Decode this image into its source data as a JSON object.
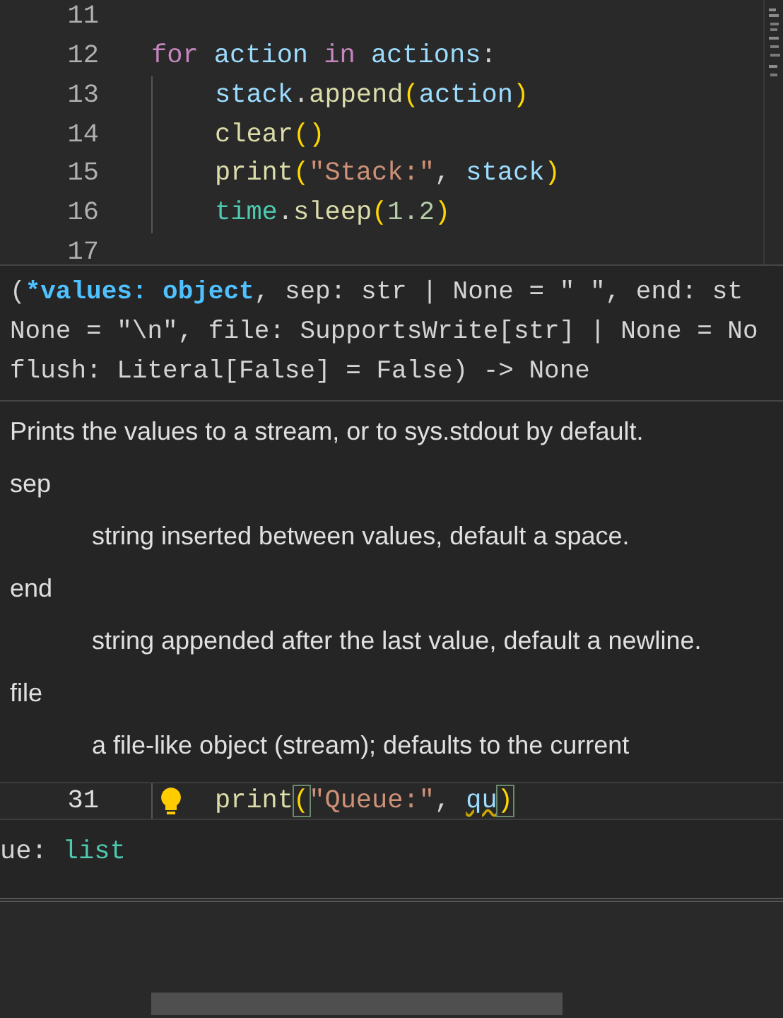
{
  "editor": {
    "lines": [
      {
        "number": "11"
      },
      {
        "number": "12",
        "tokens": [
          {
            "text": "for ",
            "kind": "keyword"
          },
          {
            "text": "action ",
            "kind": "variable"
          },
          {
            "text": "in ",
            "kind": "keyword"
          },
          {
            "text": "actions",
            "kind": "variable"
          },
          {
            "text": ":"
          }
        ],
        "children": [
          {
            "number": "13",
            "tokens": [
              {
                "text": "stack",
                "kind": "variable"
              },
              {
                "text": "."
              },
              {
                "text": "append",
                "kind": "function"
              },
              {
                "text": "(",
                "kind": "paren"
              },
              {
                "text": "action",
                "kind": "variable"
              },
              {
                "text": ")",
                "kind": "paren"
              }
            ]
          },
          {
            "number": "14",
            "tokens": [
              {
                "text": "clear",
                "kind": "function"
              },
              {
                "text": "()",
                "kind": "paren"
              }
            ]
          },
          {
            "number": "15",
            "tokens": [
              {
                "text": "print",
                "kind": "function"
              },
              {
                "text": "(",
                "kind": "paren"
              },
              {
                "text": "\"Stack:\"",
                "kind": "string"
              },
              {
                "text": ", "
              },
              {
                "text": "stack",
                "kind": "variable"
              },
              {
                "text": ")",
                "kind": "paren"
              }
            ]
          },
          {
            "number": "16",
            "tokens": [
              {
                "text": "time",
                "kind": "module"
              },
              {
                "text": "."
              },
              {
                "text": "sleep",
                "kind": "function"
              },
              {
                "text": "(",
                "kind": "paren"
              },
              {
                "text": "1.2",
                "kind": "number"
              },
              {
                "text": ")",
                "kind": "paren"
              }
            ]
          }
        ]
      },
      {
        "number": "17"
      }
    ]
  },
  "signature_hover": {
    "signature_lines": [
      [
        {
          "text": "(",
          "kind": "plain"
        },
        {
          "text": "*values: object",
          "kind": "active-param"
        },
        {
          "text": ", sep: str | None = \" \", end: st",
          "kind": "plain"
        }
      ],
      [
        {
          "text": "None = \"\\n\", file: SupportsWrite[str] | None = No",
          "kind": "plain"
        }
      ],
      [
        {
          "text": "flush: Literal[False] = False) -> None",
          "kind": "plain"
        }
      ]
    ],
    "summary": "Prints the values to a stream, or to sys.stdout by default.",
    "params": [
      {
        "name": "sep",
        "description": "string inserted between values, default a space."
      },
      {
        "name": "end",
        "description": "string appended after the last value, default a newline."
      },
      {
        "name": "file",
        "description": "a file-like object (stream); defaults to the current"
      }
    ]
  },
  "current_line": {
    "number": "31",
    "tokens": [
      {
        "text": "print",
        "kind": "function"
      },
      {
        "text": "(",
        "kind": "paren-match"
      },
      {
        "text": "\"Queue:\"",
        "kind": "string"
      },
      {
        "text": ", "
      },
      {
        "text": "qu",
        "kind": "warning"
      },
      {
        "text": ")",
        "kind": "paren-match"
      }
    ]
  },
  "type_hover": {
    "tokens": [
      {
        "text": "ue: ",
        "kind": "plain"
      },
      {
        "text": "list",
        "kind": "module"
      }
    ]
  }
}
